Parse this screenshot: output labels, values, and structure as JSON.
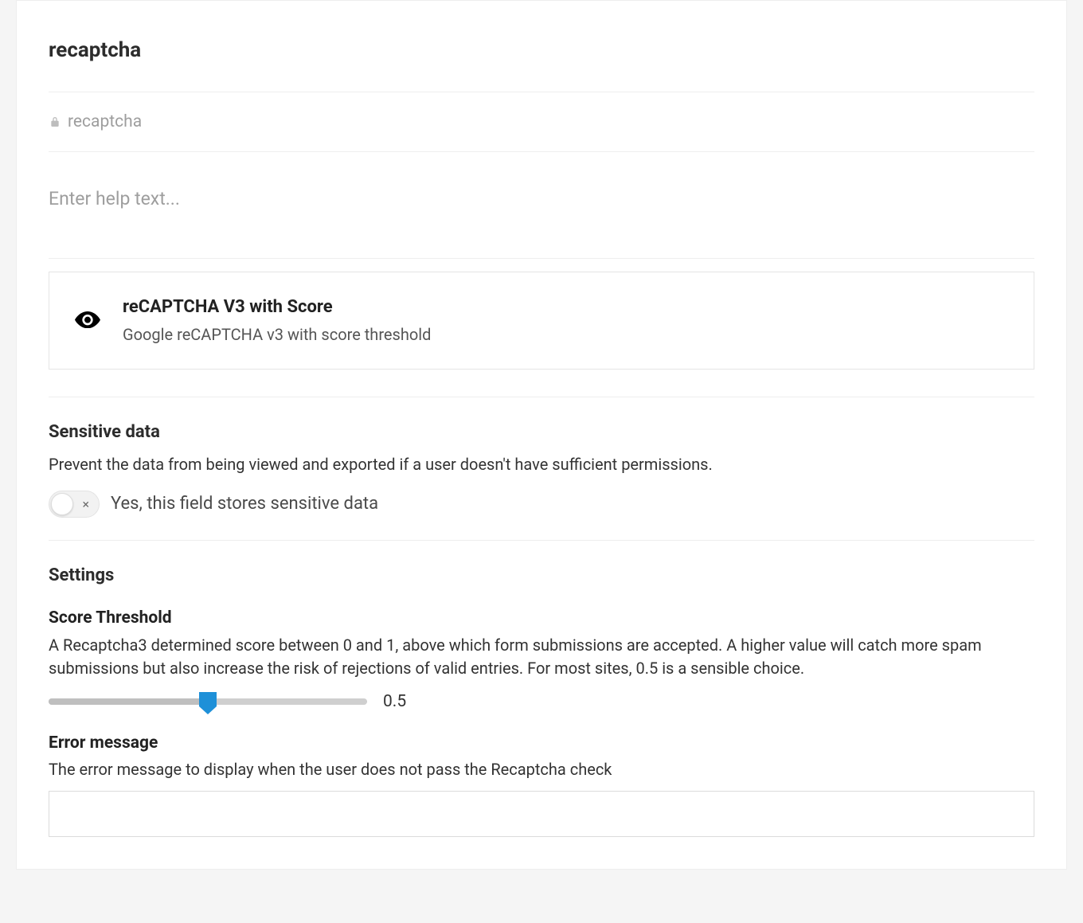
{
  "panel": {
    "title": "recaptcha",
    "id": "recaptcha",
    "help_placeholder": "Enter help text..."
  },
  "field_type": {
    "title": "reCAPTCHA V3 with Score",
    "subtitle": "Google reCAPTCHA v3 with score threshold",
    "icon": "eye-icon"
  },
  "sensitive": {
    "heading": "Sensitive data",
    "description": "Prevent the data from being viewed and exported if a user doesn't have sufficient permissions.",
    "label": "Yes, this field stores sensitive data",
    "enabled_glyph": "×",
    "enabled": false
  },
  "settings": {
    "heading": "Settings",
    "score_threshold": {
      "label": "Score Threshold",
      "description": "A Recaptcha3 determined score between 0 and 1, above which form submissions are accepted. A higher value will catch more spam submissions but also increase the risk of rejections of valid entries. For most sites, 0.5 is a sensible choice.",
      "value": 0.5,
      "display": "0.5",
      "min": 0,
      "max": 1
    },
    "error_message": {
      "label": "Error message",
      "description": "The error message to display when the user does not pass the Recaptcha check",
      "value": ""
    }
  }
}
